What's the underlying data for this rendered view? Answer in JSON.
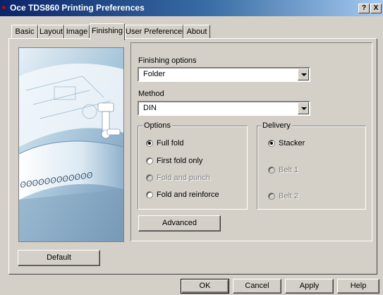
{
  "window": {
    "title": "Oce TDS860 Printing Preferences",
    "help_label": "?",
    "close_label": "X"
  },
  "tabs": [
    {
      "label": "Basic"
    },
    {
      "label": "Layout"
    },
    {
      "label": "Image"
    },
    {
      "label": "Finishing"
    },
    {
      "label": "User Preferences"
    },
    {
      "label": "About"
    }
  ],
  "active_tab": "Finishing",
  "finishing": {
    "finishing_options_label": "Finishing options",
    "finishing_options_value": "Folder",
    "method_label": "Method",
    "method_value": "DIN",
    "options_group_label": "Options",
    "options": [
      {
        "label": "Full fold",
        "checked": true,
        "enabled": true
      },
      {
        "label": "First fold only",
        "checked": false,
        "enabled": true
      },
      {
        "label": "Fold and punch",
        "checked": false,
        "enabled": false
      },
      {
        "label": "Fold and reinforce",
        "checked": false,
        "enabled": true
      }
    ],
    "delivery_group_label": "Delivery",
    "delivery": [
      {
        "label": "Stacker",
        "checked": true,
        "enabled": true
      },
      {
        "label": "Belt 1",
        "checked": false,
        "enabled": false
      },
      {
        "label": "Belt 2",
        "checked": false,
        "enabled": false
      }
    ],
    "advanced_label": "Advanced",
    "default_label": "Default"
  },
  "footer": {
    "ok_label": "OK",
    "cancel_label": "Cancel",
    "apply_label": "Apply",
    "help_label": "Help"
  },
  "colors": {
    "title_start": "#0a246a",
    "title_end": "#a6caf0",
    "face": "#d4d0c8"
  }
}
